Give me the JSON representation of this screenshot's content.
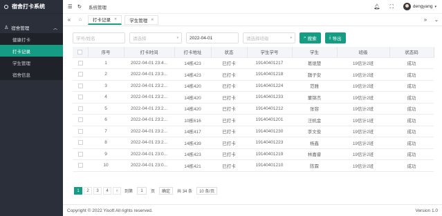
{
  "app": {
    "title": "宿舍打卡系统"
  },
  "sidebar": {
    "group_label": "宿舍管理",
    "items": [
      {
        "label": "健康打卡",
        "active": false
      },
      {
        "label": "打卡记录",
        "active": true
      },
      {
        "label": "学生管理",
        "active": false
      },
      {
        "label": "宿舍信息",
        "active": false
      }
    ]
  },
  "topbar": {
    "breadcrumb": "系统管理",
    "username": "dengyang"
  },
  "tabs": [
    {
      "label": "打卡记录",
      "active": true
    },
    {
      "label": "学生管理",
      "active": false
    }
  ],
  "filters": {
    "student_placeholder": "学号/姓名",
    "select1_placeholder": "请选择",
    "date_value": "2022-04-01",
    "class_placeholder": "请选择班级",
    "search_label": "搜索",
    "export_label": "导出"
  },
  "table": {
    "columns": [
      "序号",
      "打卡时间",
      "打卡地址",
      "状态",
      "学生学号",
      "学生",
      "班级",
      "状态码"
    ],
    "rows": [
      [
        "1",
        "2022-04-01 23:4...",
        "14栋423",
        "已打卡",
        "19140401217",
        "葛焜楚",
        "19信计2班",
        "成功"
      ],
      [
        "2",
        "2022-04-01 23:3...",
        "14栋423",
        "已打卡",
        "19140401218",
        "魏子安",
        "19信计2班",
        "成功"
      ],
      [
        "3",
        "2022-04-01 23:2...",
        "14栋420",
        "已打卡",
        "19140401224",
        "范雅",
        "19信计2班",
        "成功"
      ],
      [
        "4",
        "2022-04-01 23:2...",
        "14栋420",
        "已打卡",
        "19140401233",
        "董锦杰",
        "19信计2班",
        "成功"
      ],
      [
        "5",
        "2022-04-01 23:2...",
        "14栋420",
        "已打卡",
        "19140401212",
        "张容",
        "19信计2班",
        "成功"
      ],
      [
        "6",
        "2022-04-01 23:2...",
        "10栋616",
        "已打卡",
        "19140401201",
        "汪帆金",
        "19信计1班",
        "成功"
      ],
      [
        "7",
        "2022-04-01 23:2...",
        "14栋417",
        "已打卡",
        "19140401230",
        "李文俊",
        "19信计2班",
        "成功"
      ],
      [
        "8",
        "2022-04-01 23:2...",
        "14栋439",
        "已打卡",
        "19140401223",
        "杨鑫",
        "19信计2班",
        "成功"
      ],
      [
        "9",
        "2022-04-01 23:0...",
        "14栋423",
        "已打卡",
        "19140401219",
        "林嘉睿",
        "19信计2班",
        "成功"
      ],
      [
        "10",
        "2022-04-01 23:0...",
        "14栋421",
        "已打卡",
        "19140401210",
        "陈霖",
        "19信计2班",
        "成功"
      ]
    ]
  },
  "pager": {
    "pages": [
      "1",
      "2",
      "3",
      "4"
    ],
    "next": "›",
    "goto_label": "到第",
    "goto_value": "1",
    "page_unit": "页",
    "confirm": "确定",
    "total": "共 34 条",
    "page_size": "10 条/页"
  },
  "footer": {
    "copyright": "Copyright © 2022 Yisoft All rights reserved.",
    "version": "Version 1.0"
  },
  "colors": {
    "accent": "#159c85",
    "sidebar_bg": "#2b2f3a"
  }
}
